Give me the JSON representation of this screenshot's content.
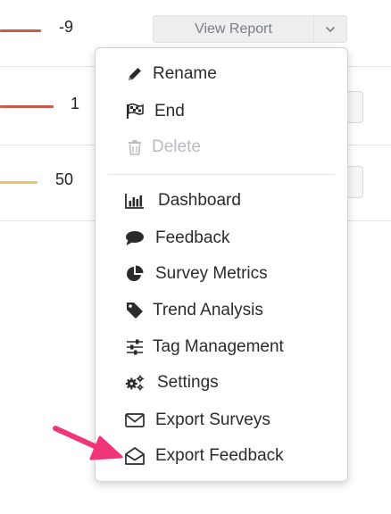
{
  "rows": [
    {
      "score": "-9",
      "bar_color": "#cf5a4c"
    },
    {
      "score": "1",
      "bar_color": "#cf5a4c"
    },
    {
      "score": "50",
      "bar_color": "#f0c36a"
    }
  ],
  "toolbar": {
    "view_report_label": "View Report"
  },
  "menu": {
    "items": [
      {
        "label": "Rename",
        "icon": "pencil-icon",
        "enabled": true
      },
      {
        "label": "End",
        "icon": "checkered-flag-icon",
        "enabled": true
      },
      {
        "label": "Delete",
        "icon": "trash-icon",
        "enabled": false
      },
      {
        "label": "Dashboard",
        "icon": "bar-chart-icon",
        "enabled": true
      },
      {
        "label": "Feedback",
        "icon": "speech-bubble-icon",
        "enabled": true
      },
      {
        "label": "Survey Metrics",
        "icon": "pie-chart-icon",
        "enabled": true
      },
      {
        "label": "Trend Analysis",
        "icon": "tag-icon",
        "enabled": true
      },
      {
        "label": "Tag Management",
        "icon": "sliders-icon",
        "enabled": true
      },
      {
        "label": "Settings",
        "icon": "gears-icon",
        "enabled": true
      },
      {
        "label": "Export Surveys",
        "icon": "envelope-icon",
        "enabled": true
      },
      {
        "label": "Export Feedback",
        "icon": "envelope-open-icon",
        "enabled": true
      }
    ]
  },
  "colors": {
    "accent_arrow": "#f0357a",
    "disabled_text": "#b9bcbf"
  }
}
